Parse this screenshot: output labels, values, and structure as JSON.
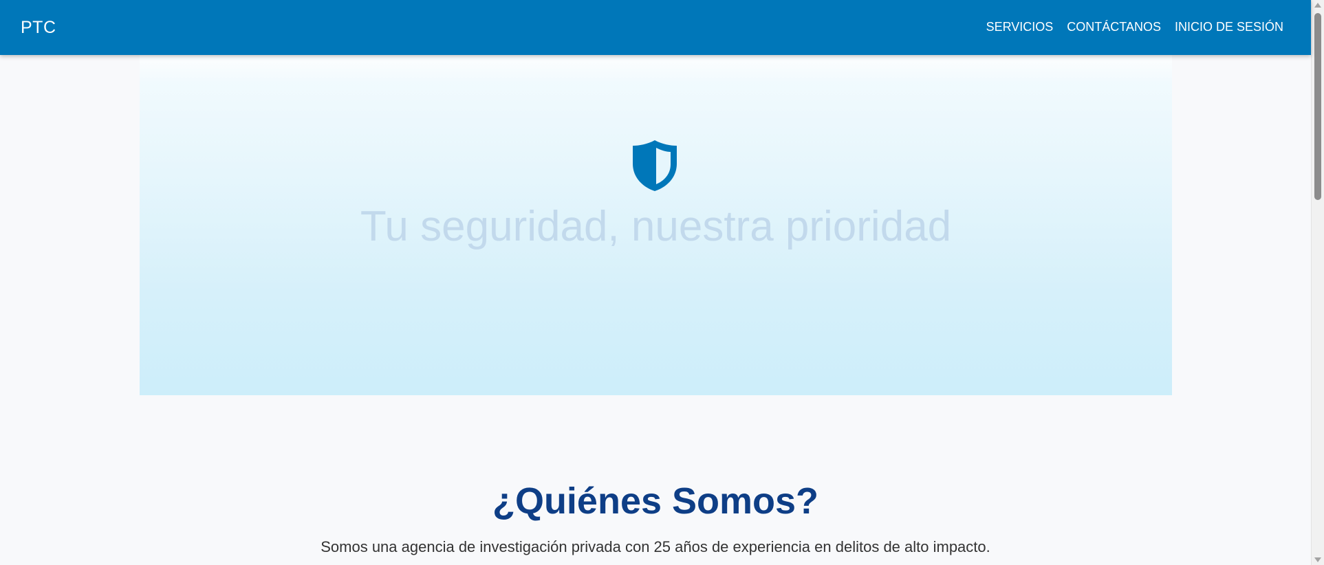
{
  "navbar": {
    "brand": "PTC",
    "links": [
      {
        "label": "SERVICIOS"
      },
      {
        "label": "CONTÁCTANOS"
      },
      {
        "label": "INICIO DE SESIÓN"
      }
    ],
    "background_color": "#0077b9"
  },
  "hero": {
    "icon": "shield-icon",
    "title": "Tu seguridad, nuestra prioridad"
  },
  "about": {
    "title": "¿Quiénes Somos?",
    "text": "Somos una agencia de investigación privada con 25 años de experiencia en delitos de alto impacto."
  },
  "colors": {
    "accent": "#0077b9",
    "heading": "#0e3e86",
    "hero_title": "#c2d9ec"
  }
}
